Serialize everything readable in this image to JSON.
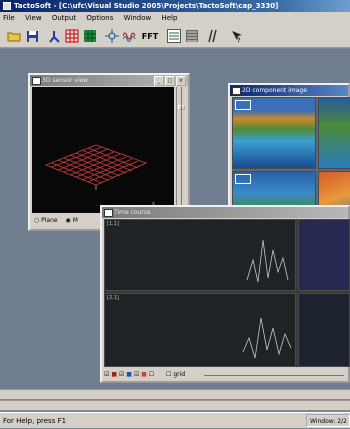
{
  "app": {
    "title": "TactoSoft - [C:\\ufc\\Visual Studio 2005\\Projects\\TactoSoft\\cap_3330]"
  },
  "menu": [
    "File",
    "View",
    "Output",
    "Options",
    "Window",
    "Help"
  ],
  "toolbar": {
    "fft_label": "FFT"
  },
  "windows": {
    "view3d": {
      "title": "3D sensor view"
    },
    "view3d_options": [
      "Plane",
      "M"
    ],
    "comp": {
      "title": "2D component image"
    },
    "time": {
      "title": "Time course"
    },
    "time_controls": {
      "checkbox_label": "grid"
    }
  },
  "status": {
    "help_text": "For Help, press F1",
    "panel_text": "Window: 2/2"
  },
  "colors": {
    "accent": "#0a246a",
    "desktop": "#6f7d8e"
  }
}
